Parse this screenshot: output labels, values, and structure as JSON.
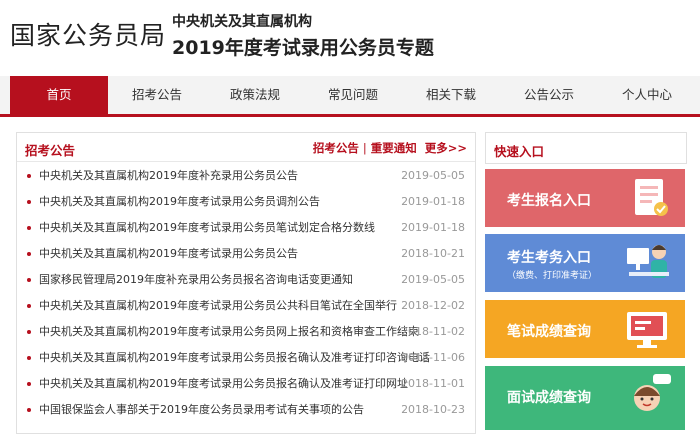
{
  "header": {
    "brand": "国家公务员局",
    "sub1": "中央机关及其直属机构",
    "sub2": "2019年度考试录用公务员专题"
  },
  "nav": {
    "items": [
      "首页",
      "招考公告",
      "政策法规",
      "常见问题",
      "相关下载",
      "公告公示",
      "个人中心"
    ],
    "active_index": 0
  },
  "news": {
    "title": "招考公告",
    "link1": "招考公告",
    "link2": "重要通知",
    "more": "更多>>",
    "items": [
      {
        "title": "中央机关及其直属机构2019年度补充录用公务员公告",
        "date": "2019-05-05"
      },
      {
        "title": "中央机关及其直属机构2019年度考试录用公务员调剂公告",
        "date": "2019-01-18"
      },
      {
        "title": "中央机关及其直属机构2019年度考试录用公务员笔试划定合格分数线",
        "date": "2019-01-18"
      },
      {
        "title": "中央机关及其直属机构2019年度考试录用公务员公告",
        "date": "2018-10-21"
      },
      {
        "title": "国家移民管理局2019年度补充录用公务员报名咨询电话变更通知",
        "date": "2019-05-05"
      },
      {
        "title": "中央机关及其直属机构2019年度考试录用公务员公共科目笔试在全国举行",
        "date": "2018-12-02"
      },
      {
        "title": "中央机关及其直属机构2019年度考试录用公务员网上报名和资格审查工作结束",
        "date": "2018-11-02"
      },
      {
        "title": "中央机关及其直属机构2019年度考试录用公务员报名确认及准考证打印咨询电话",
        "date": "2018-11-06"
      },
      {
        "title": "中央机关及其直属机构2019年度考试录用公务员报名确认及准考证打印网址",
        "date": "2018-11-01"
      },
      {
        "title": "中国银保监会人事部关于2019年度公务员录用考试有关事项的公告",
        "date": "2018-10-23"
      }
    ]
  },
  "quick": {
    "title": "快速入口",
    "cards": [
      {
        "label": "考生报名入口",
        "icon": "registration-form-icon",
        "color": "#df666a"
      },
      {
        "label": "考生考务入口",
        "sub": "（缴费、打印准考证）",
        "icon": "person-at-computer-icon",
        "color": "#5f8bd6"
      },
      {
        "label": "笔试成绩查询",
        "icon": "monitor-score-icon",
        "color": "#f5a623"
      },
      {
        "label": "面试成绩查询",
        "icon": "interview-person-icon",
        "color": "#3eb77b"
      }
    ]
  },
  "colors": {
    "primary": "#b6101e"
  }
}
